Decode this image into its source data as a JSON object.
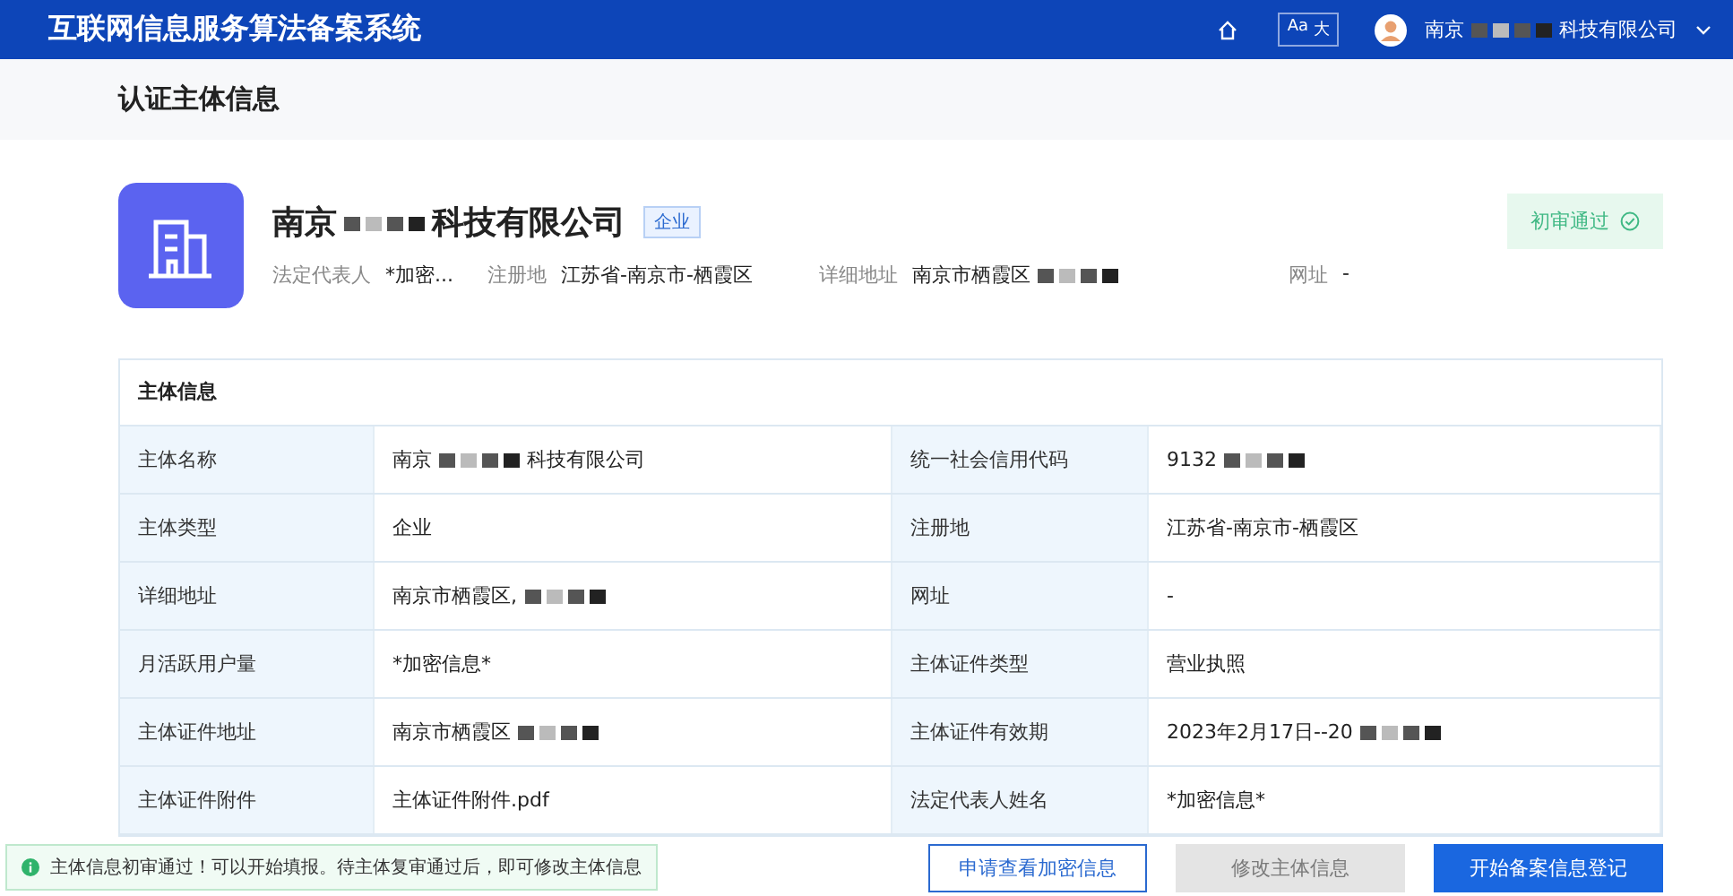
{
  "header": {
    "title": "互联网信息服务算法备案系统",
    "font_toggle": {
      "small": "Aa",
      "large": "大"
    },
    "user": [
      {
        "kind": "text",
        "text": "南京"
      },
      {
        "kind": "redacted"
      },
      {
        "kind": "text",
        "text": "科技有限公司"
      }
    ]
  },
  "page_title": "认证主体信息",
  "entity": {
    "name": [
      {
        "kind": "text",
        "text": "南京"
      },
      {
        "kind": "redacted"
      },
      {
        "kind": "text",
        "text": "科技有限公司"
      }
    ],
    "tag": "企业",
    "status": "初审通过",
    "fields": [
      {
        "label": "法定代表人",
        "value": [
          {
            "kind": "text",
            "text": "*加密..."
          }
        ]
      },
      {
        "label": "注册地",
        "value": [
          {
            "kind": "text",
            "text": "江苏省-南京市-栖霞区"
          }
        ]
      },
      {
        "label": "详细地址",
        "value": [
          {
            "kind": "text",
            "text": "南京市栖霞区"
          },
          {
            "kind": "redacted"
          }
        ]
      },
      {
        "label": "网址",
        "value": [
          {
            "kind": "text",
            "text": "-"
          }
        ]
      }
    ]
  },
  "table": {
    "title": "主体信息",
    "rows": [
      [
        {
          "label": "主体名称",
          "value": [
            {
              "kind": "text",
              "text": "南京"
            },
            {
              "kind": "redacted"
            },
            {
              "kind": "text",
              "text": "科技有限公司"
            }
          ]
        },
        {
          "label": "统一社会信用代码",
          "value": [
            {
              "kind": "text",
              "text": "9132"
            },
            {
              "kind": "redacted"
            }
          ]
        }
      ],
      [
        {
          "label": "主体类型",
          "value": [
            {
              "kind": "text",
              "text": "企业"
            }
          ]
        },
        {
          "label": "注册地",
          "value": [
            {
              "kind": "text",
              "text": "江苏省-南京市-栖霞区"
            }
          ]
        }
      ],
      [
        {
          "label": "详细地址",
          "value": [
            {
              "kind": "text",
              "text": "南京市栖霞区,"
            },
            {
              "kind": "redacted"
            }
          ]
        },
        {
          "label": "网址",
          "value": [
            {
              "kind": "text",
              "text": "-"
            }
          ]
        }
      ],
      [
        {
          "label": "月活跃用户量",
          "value": [
            {
              "kind": "text",
              "text": "*加密信息*"
            }
          ]
        },
        {
          "label": "主体证件类型",
          "value": [
            {
              "kind": "text",
              "text": "营业执照"
            }
          ]
        }
      ],
      [
        {
          "label": "主体证件地址",
          "value": [
            {
              "kind": "text",
              "text": "南京市栖霞区"
            },
            {
              "kind": "redacted"
            }
          ]
        },
        {
          "label": "主体证件有效期",
          "value": [
            {
              "kind": "text",
              "text": "2023年2月17日--20"
            },
            {
              "kind": "redacted"
            }
          ]
        }
      ],
      [
        {
          "label": "主体证件附件",
          "value": [
            {
              "kind": "text",
              "text": "主体证件附件.pdf"
            }
          ]
        },
        {
          "label": "法定代表人姓名",
          "value": [
            {
              "kind": "text",
              "text": "*加密信息*"
            }
          ]
        }
      ]
    ]
  },
  "footer": {
    "notice": "主体信息初审通过！可以开始填报。待主体复审通过后，即可修改主体信息",
    "buttons": [
      {
        "label": "申请查看加密信息",
        "kind": "outline",
        "disabled": false
      },
      {
        "label": "修改主体信息",
        "kind": "solid",
        "disabled": true
      },
      {
        "label": "开始备案信息登记",
        "kind": "solid",
        "disabled": false
      }
    ]
  }
}
